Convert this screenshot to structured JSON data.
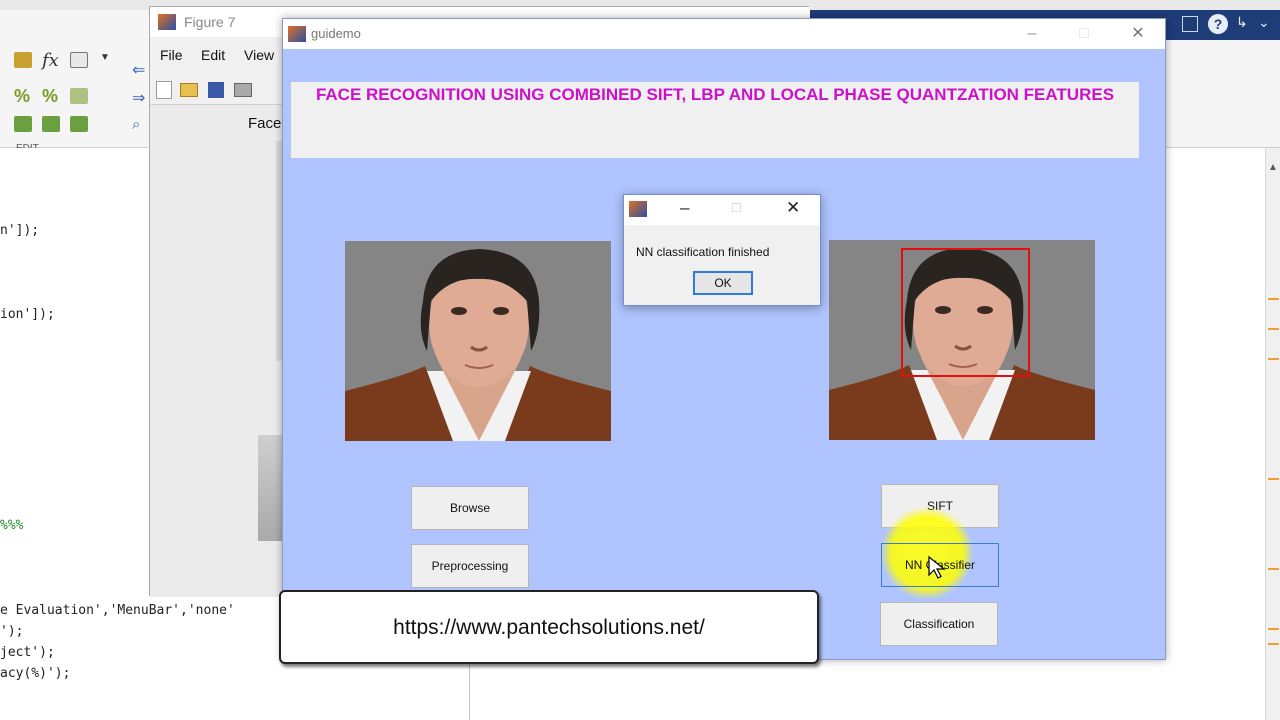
{
  "matlab": {
    "toolstrip_section": "EDIT",
    "code_lines": [
      {
        "text": "n']);",
        "kind": "code"
      },
      {
        "text": "ion']);",
        "kind": "code"
      },
      {
        "text": "%%%",
        "kind": "comment"
      },
      {
        "text": "e Evaluation','MenuBar','none'",
        "kind": "code"
      },
      {
        "text": "');",
        "kind": "code"
      },
      {
        "text": "ject');",
        "kind": "code"
      },
      {
        "text": "acy(%)');",
        "kind": "code"
      }
    ]
  },
  "figure7": {
    "title": "Figure 7",
    "menu": [
      "File",
      "Edit",
      "View"
    ],
    "canvas_label": "Face"
  },
  "guidemo": {
    "window_title": "guidemo",
    "title": "FACE  RECOGNITION USING COMBINED SIFT, LBP AND LOCAL PHASE QUANTZATION FEATURES",
    "buttons": {
      "browse": "Browse",
      "preprocessing": "Preprocessing",
      "sift": "SIFT",
      "nn_classifier": "NN Classifier",
      "classification": "Classification"
    }
  },
  "dialog": {
    "message": "NN classification finished",
    "ok_label": "OK"
  },
  "banner": {
    "url": "https://www.pantechsolutions.net/"
  },
  "colors": {
    "gui_background": "#b0c4ff",
    "title_text": "#cc10cc",
    "face_box": "#e01010",
    "highlight": "#ffff00"
  }
}
